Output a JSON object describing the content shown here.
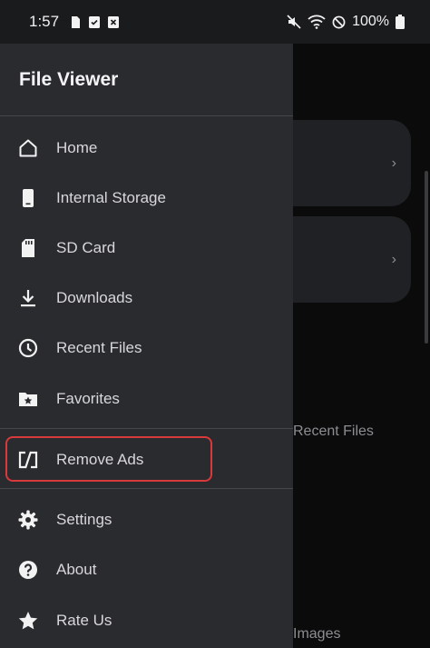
{
  "status_bar": {
    "time": "1:57",
    "battery": "100%",
    "left_icons": [
      "sim-icon",
      "checkbox-icon",
      "close-box-icon"
    ],
    "right_icons": [
      "mute-icon",
      "wifi-icon",
      "do-not-disturb-icon",
      "battery-icon"
    ]
  },
  "drawer": {
    "title": "File Viewer",
    "items": [
      {
        "label": "Home",
        "icon": "home-icon"
      },
      {
        "label": "Internal Storage",
        "icon": "phone-icon"
      },
      {
        "label": "SD Card",
        "icon": "sd-card-icon"
      },
      {
        "label": "Downloads",
        "icon": "download-icon"
      },
      {
        "label": "Recent Files",
        "icon": "clock-icon"
      },
      {
        "label": "Favorites",
        "icon": "star-folder-icon"
      },
      {
        "label": "Remove Ads",
        "icon": "remove-ads-icon"
      },
      {
        "label": "Settings",
        "icon": "gear-icon"
      },
      {
        "label": "About",
        "icon": "help-icon"
      },
      {
        "label": "Rate Us",
        "icon": "star-icon"
      }
    ]
  },
  "background": {
    "recent_files_label": "Recent Files",
    "images_label": "Images"
  },
  "colors": {
    "drawer_bg": "#2a2b2e",
    "highlight": "#d8393a",
    "text": "#d8d8dc"
  }
}
